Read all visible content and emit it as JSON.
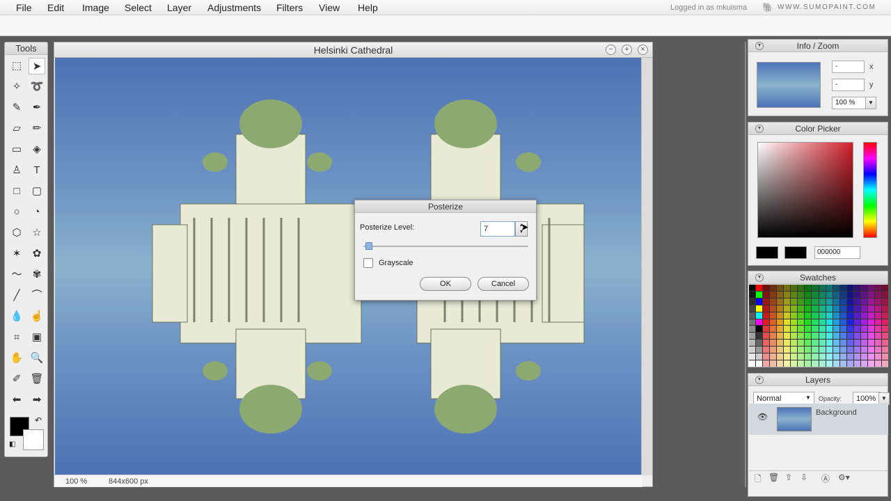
{
  "menubar": {
    "items": [
      "File",
      "Edit",
      "Image",
      "Select",
      "Layer",
      "Adjustments",
      "Filters",
      "View",
      "Help"
    ],
    "login_text": "Logged in as mkuisma",
    "site": "WWW.SUMOPAINT.COM"
  },
  "tools": {
    "title": "Tools",
    "icons": [
      "marquee-icon",
      "move-icon",
      "magic-wand-icon",
      "lasso-icon",
      "brush-icon",
      "pen-icon",
      "eraser-icon",
      "pencil-icon",
      "gradient-icon",
      "fill-icon",
      "stamp-icon",
      "text-icon",
      "rectangle-icon",
      "rounded-rectangle-icon",
      "ellipse-icon",
      "arc-icon",
      "hexagon-icon",
      "star-icon",
      "burst-icon",
      "flower-icon",
      "wave-icon",
      "flower-shape-icon",
      "line-icon",
      "curve-icon",
      "drop-icon",
      "smudge-icon",
      "crop-icon",
      "transform-icon",
      "hand-icon",
      "zoom-icon",
      "eyedropper-icon",
      "trash-icon",
      "back-icon",
      "forward-icon"
    ],
    "foreground": "#000000",
    "background": "#ffffff"
  },
  "document": {
    "title": "Helsinki Cathedral",
    "zoom": "100 %",
    "size": "844x600 px"
  },
  "dialog": {
    "title": "Posterize",
    "level_label": "Posterize Level:",
    "level_value": "7",
    "slider_level": 0.02,
    "grayscale_label": "Grayscale",
    "grayscale_checked": false,
    "ok_label": "OK",
    "cancel_label": "Cancel"
  },
  "info_zoom": {
    "title": "Info / Zoom",
    "x_value": "-",
    "y_value": "-",
    "x_label": "x",
    "y_label": "y",
    "zoom": "100 %"
  },
  "color_picker": {
    "title": "Color Picker",
    "hex": "000000"
  },
  "swatches": {
    "title": "Swatches"
  },
  "layers": {
    "title": "Layers",
    "blend_mode": "Normal",
    "opacity_label": "Opacity:",
    "opacity": "100%",
    "items": [
      {
        "name": "Background"
      }
    ]
  }
}
